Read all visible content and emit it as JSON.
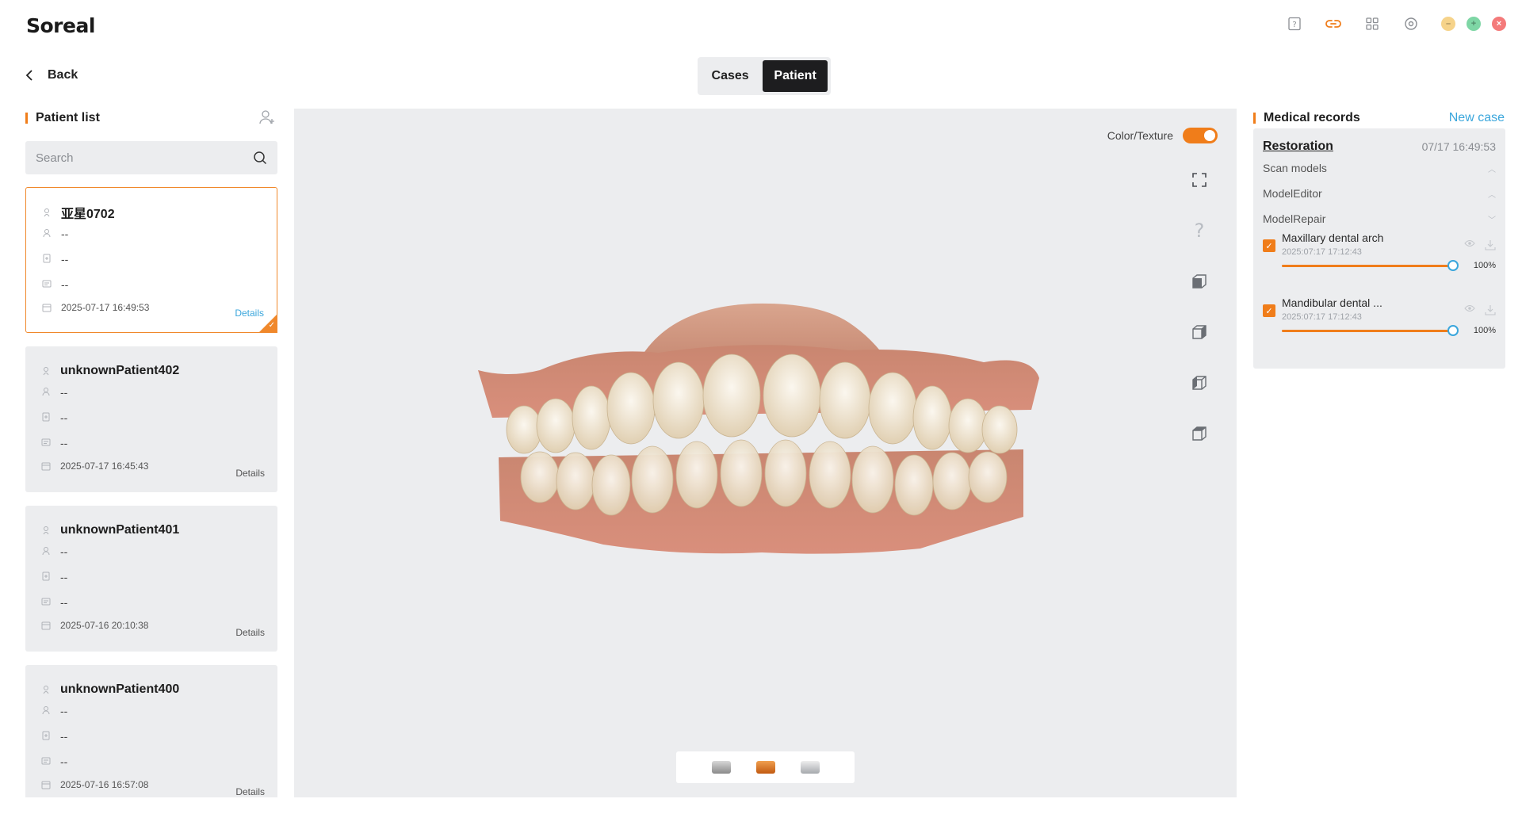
{
  "app": {
    "logo": "Soreal"
  },
  "nav": {
    "back_label": "Back",
    "tabs": [
      "Cases",
      "Patient"
    ],
    "active_tab": "Patient"
  },
  "colors": {
    "accent": "#f07d1a",
    "link": "#3aa6dc",
    "panel": "#ecedef",
    "dark": "#1d1d1f"
  },
  "patients_panel": {
    "title": "Patient list",
    "search_placeholder": "Search",
    "patients": [
      {
        "name": "亚星0702",
        "field1": "--",
        "field2": "--",
        "field3": "--",
        "datetime": "2025-07-17 16:49:53",
        "details": "Details",
        "selected": true
      },
      {
        "name": "unknownPatient402",
        "field1": "--",
        "field2": "--",
        "field3": "--",
        "datetime": "2025-07-17 16:45:43",
        "details": "Details",
        "selected": false
      },
      {
        "name": "unknownPatient401",
        "field1": "--",
        "field2": "--",
        "field3": "--",
        "datetime": "2025-07-16 20:10:38",
        "details": "Details",
        "selected": false
      },
      {
        "name": "unknownPatient400",
        "field1": "--",
        "field2": "--",
        "field3": "--",
        "datetime": "2025-07-16 16:57:08",
        "details": "Details",
        "selected": false
      }
    ]
  },
  "viewer": {
    "color_texture_label": "Color/Texture",
    "color_texture_on": true,
    "tools": [
      "fullscreen-icon",
      "help-icon",
      "front-view-icon",
      "left-view-icon",
      "right-view-icon",
      "top-view-icon"
    ]
  },
  "records_panel": {
    "title": "Medical records",
    "new_case": "New case",
    "record": {
      "type": "Restoration",
      "time": "07/17 16:49:53",
      "sections": [
        "Scan models",
        "ModelEditor",
        "ModelRepair"
      ],
      "arches": [
        {
          "name": "Maxillary dental arch",
          "date": "2025:07:17 17:12:43",
          "opacity_percent": 100,
          "opacity_label": "100%"
        },
        {
          "name": "Mandibular dental ...",
          "date": "2025:07:17 17:12:43",
          "opacity_percent": 100,
          "opacity_label": "100%"
        }
      ]
    }
  }
}
